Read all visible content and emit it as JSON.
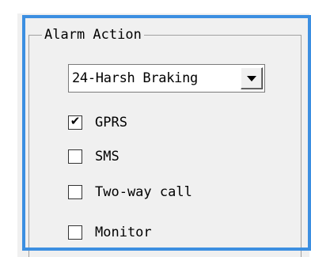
{
  "group": {
    "title": "Alarm Action"
  },
  "alarm_select": {
    "value": "24-Harsh Braking"
  },
  "options": [
    {
      "label": "GPRS",
      "checked": true,
      "check_glyph": "✔"
    },
    {
      "label": "SMS",
      "checked": false,
      "check_glyph": ""
    },
    {
      "label": "Two-way call",
      "checked": false,
      "check_glyph": ""
    },
    {
      "label": "Monitor",
      "checked": false,
      "check_glyph": ""
    }
  ],
  "colors": {
    "highlight": "#3c8fe1",
    "panel": "#f0f0f0"
  }
}
